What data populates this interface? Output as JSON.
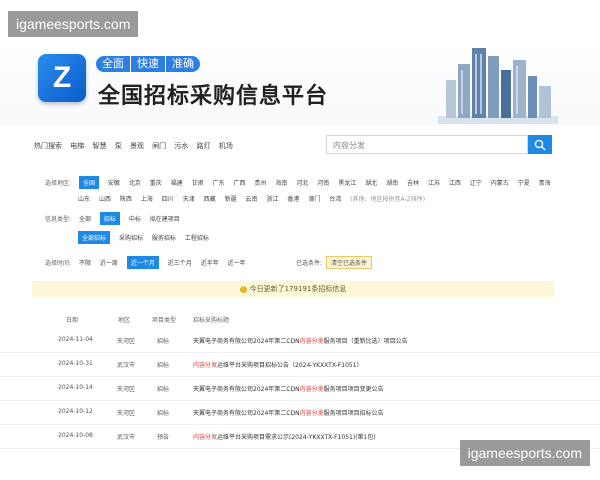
{
  "watermark": {
    "top": "igameesports.com",
    "bottom": "igameesports.com"
  },
  "brand": {
    "tags": [
      "全面",
      "快速",
      "准确"
    ],
    "title": "全国招标采购信息平台"
  },
  "hot": {
    "label": "热门搜索",
    "items": [
      "电梯",
      "智慧",
      "泵",
      "景观",
      "闸门",
      "污水",
      "路灯",
      "机场"
    ]
  },
  "search": {
    "placeholder": "内容分发"
  },
  "filters": {
    "region": {
      "label": "选择地区:",
      "row1": [
        "全国",
        "安徽",
        "北京",
        "重庆",
        "福建",
        "甘肃",
        "广东",
        "广西",
        "贵州",
        "海南",
        "河北",
        "河南",
        "黑龙江",
        "湖北",
        "湖南",
        "吉林",
        "江苏",
        "江西",
        "辽宁",
        "内蒙古",
        "宁夏",
        "青海"
      ],
      "row2": [
        "山东",
        "山西",
        "陕西",
        "上海",
        "四川",
        "天津",
        "西藏",
        "新疆",
        "云南",
        "浙江",
        "香港",
        "澳门",
        "台湾"
      ],
      "note": "(其他、地区按拼音A-Z排序)"
    },
    "type": {
      "label": "信息类型:",
      "items": [
        "全部",
        "招标",
        "中标",
        "拟在建项目"
      ],
      "sub": [
        "全部招标",
        "采购招标",
        "服务招标",
        "工程招标"
      ]
    },
    "time": {
      "label": "选择时间:",
      "items": [
        "不限",
        "近一周",
        "近一个月",
        "近三个月",
        "近半年",
        "近一年"
      ]
    },
    "condition_label": "已选条件:",
    "condition_btn": "清空已选条件"
  },
  "banner": {
    "icon": "!",
    "text": "今日更新了179191条招标信息"
  },
  "table": {
    "headers": [
      "日期",
      "地区",
      "项目类型",
      "招标采购标题"
    ],
    "rows": [
      {
        "date": "2024-11-04",
        "region": "天河区",
        "type": "招标",
        "pre": "天翼电子商务有限公司2024年第二CDN",
        "hl": "内容分发",
        "post": "服务项目（重新比选）项目公告"
      },
      {
        "date": "2024-10-31",
        "region": "武汉市",
        "type": "招标",
        "pre": "",
        "hl": "内容分发",
        "post": "运维平台采购项目招标公告（2024-YKXXTX-F1051）"
      },
      {
        "date": "2024-10-14",
        "region": "天河区",
        "type": "招标",
        "pre": "天翼电子商务有限公司2024年第二CDN",
        "hl": "内容分发",
        "post": "服务项目项目变更公告"
      },
      {
        "date": "2024-10-12",
        "region": "天河区",
        "type": "招标",
        "pre": "天翼电子商务有限公司2024年第二CDN",
        "hl": "内容分发",
        "post": "服务项目项目招标公告"
      },
      {
        "date": "2024-10-08",
        "region": "武汉市",
        "type": "预告",
        "pre": "",
        "hl": "内容分发",
        "post": "运维平台采购项目需求公示(2024-YKXXTX-F1051)(第1包)"
      }
    ]
  }
}
